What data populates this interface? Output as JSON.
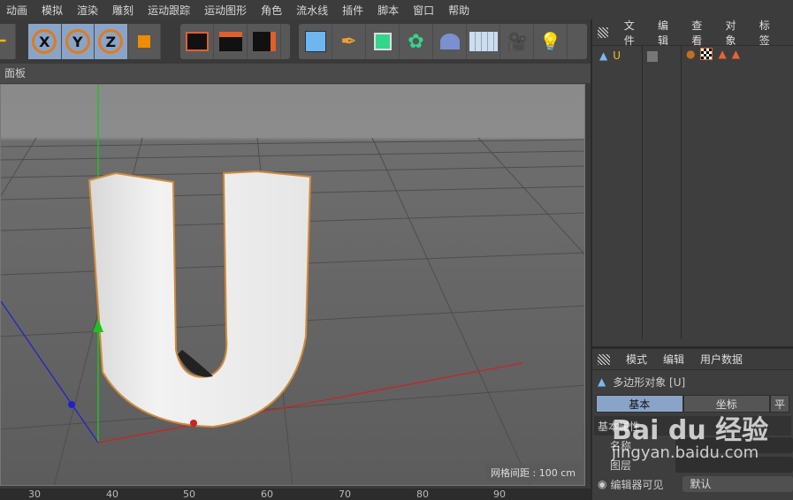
{
  "menu": [
    "动画",
    "模拟",
    "渲染",
    "雕刻",
    "运动跟踪",
    "运动图形",
    "角色",
    "流水线",
    "插件",
    "脚本",
    "窗口",
    "帮助"
  ],
  "toolbar": {
    "axes": [
      "X",
      "Y",
      "Z"
    ]
  },
  "panel": {
    "title": "面板"
  },
  "viewport": {
    "grid_spacing": "网格间距 : 100 cm",
    "accent": "#e08a30"
  },
  "timeline": {
    "ticks": [
      "30",
      "40",
      "50",
      "60",
      "70",
      "80",
      "90"
    ]
  },
  "object_manager": {
    "menu": [
      "文件",
      "编辑",
      "查看",
      "对象",
      "标签"
    ],
    "objects": [
      {
        "name": "U"
      }
    ]
  },
  "attributes": {
    "menu": [
      "模式",
      "编辑",
      "用户数据"
    ],
    "object_title": "多边形对象 [U]",
    "tabs": [
      "基本",
      "坐标",
      "平"
    ],
    "section": "基本属性",
    "fields": [
      {
        "label": "名称",
        "value": ""
      },
      {
        "label": "图层",
        "value": ""
      },
      {
        "label": "编辑器可见",
        "value": "默认"
      }
    ]
  },
  "watermark": {
    "brand": "Bai du 经验",
    "url": "jingyan.baidu.com"
  }
}
